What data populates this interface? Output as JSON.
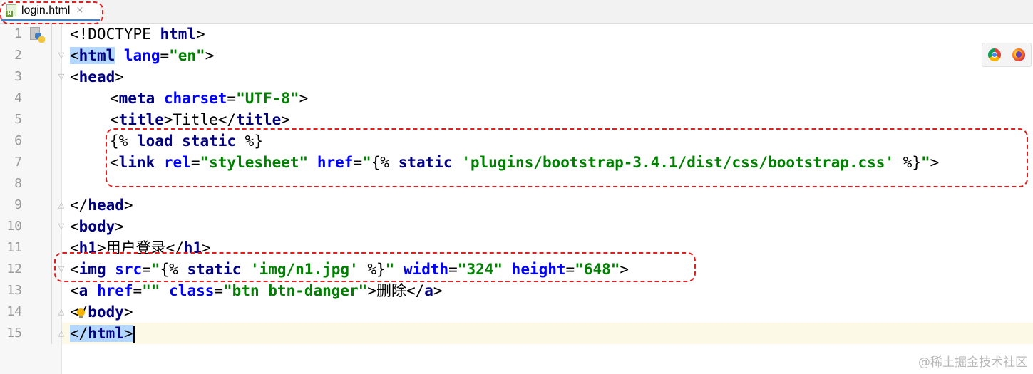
{
  "tab": {
    "label": "login.html",
    "close": "×"
  },
  "lines": [
    {
      "n": "1",
      "code": [
        [
          "p",
          "<!DOCTYPE "
        ],
        [
          "t",
          "html"
        ],
        [
          "p",
          ">"
        ]
      ]
    },
    {
      "n": "2",
      "code": [
        [
          "p hl",
          "<"
        ],
        [
          "t hl",
          "html"
        ],
        [
          "p",
          " "
        ],
        [
          "a",
          "lang"
        ],
        [
          "p",
          "="
        ],
        [
          "v",
          "\"en\""
        ],
        [
          "p",
          ">"
        ]
      ]
    },
    {
      "n": "3",
      "code": [
        [
          "p",
          "<"
        ],
        [
          "t",
          "head"
        ],
        [
          "p",
          ">"
        ]
      ]
    },
    {
      "n": "4",
      "indent": true,
      "code": [
        [
          "p",
          "<"
        ],
        [
          "t",
          "meta"
        ],
        [
          "p",
          " "
        ],
        [
          "a",
          "charset"
        ],
        [
          "p",
          "="
        ],
        [
          "v",
          "\"UTF-8\""
        ],
        [
          "p",
          ">"
        ]
      ]
    },
    {
      "n": "5",
      "indent": true,
      "code": [
        [
          "p",
          "<"
        ],
        [
          "t",
          "title"
        ],
        [
          "p",
          ">Title</"
        ],
        [
          "t",
          "title"
        ],
        [
          "p",
          ">"
        ]
      ]
    },
    {
      "n": "6",
      "indent": true,
      "code": [
        [
          "p",
          "{% "
        ],
        [
          "k",
          "load"
        ],
        [
          "p",
          " "
        ],
        [
          "k",
          "static"
        ],
        [
          "p",
          " %}"
        ]
      ]
    },
    {
      "n": "7",
      "indent": true,
      "code": [
        [
          "p",
          "<"
        ],
        [
          "t",
          "link"
        ],
        [
          "p",
          " "
        ],
        [
          "a",
          "rel"
        ],
        [
          "p",
          "="
        ],
        [
          "v",
          "\"stylesheet\""
        ],
        [
          "p",
          " "
        ],
        [
          "a",
          "href"
        ],
        [
          "p",
          "="
        ],
        [
          "v",
          "\""
        ],
        [
          "p",
          "{% "
        ],
        [
          "k",
          "static"
        ],
        [
          "p",
          " "
        ],
        [
          "v",
          "'plugins/bootstrap-3.4.1/dist/css/bootstrap.css'"
        ],
        [
          "p",
          " %}"
        ],
        [
          "v",
          "\""
        ],
        [
          "p",
          ">"
        ]
      ]
    },
    {
      "n": "8",
      "code": []
    },
    {
      "n": "9",
      "code": [
        [
          "p",
          "</"
        ],
        [
          "t",
          "head"
        ],
        [
          "p",
          ">"
        ]
      ]
    },
    {
      "n": "10",
      "code": [
        [
          "p",
          "<"
        ],
        [
          "t",
          "body"
        ],
        [
          "p",
          ">"
        ]
      ]
    },
    {
      "n": "11",
      "code": [
        [
          "p",
          "<"
        ],
        [
          "t",
          "h1"
        ],
        [
          "p",
          ">用户登录</"
        ],
        [
          "t",
          "h1"
        ],
        [
          "p",
          ">"
        ]
      ]
    },
    {
      "n": "12",
      "code": [
        [
          "p",
          "<"
        ],
        [
          "t",
          "img"
        ],
        [
          "p",
          " "
        ],
        [
          "a",
          "src"
        ],
        [
          "p",
          "="
        ],
        [
          "v",
          "\""
        ],
        [
          "p",
          "{% "
        ],
        [
          "k",
          "static"
        ],
        [
          "p",
          " "
        ],
        [
          "v",
          "'img/n1.jpg'"
        ],
        [
          "p",
          " %}"
        ],
        [
          "v",
          "\""
        ],
        [
          "p",
          " "
        ],
        [
          "a",
          "width"
        ],
        [
          "p",
          "="
        ],
        [
          "v",
          "\"324\""
        ],
        [
          "p",
          " "
        ],
        [
          "a",
          "height"
        ],
        [
          "p",
          "="
        ],
        [
          "v",
          "\"648\""
        ],
        [
          "p",
          ">"
        ]
      ]
    },
    {
      "n": "13",
      "code": [
        [
          "p",
          "<"
        ],
        [
          "t",
          "a"
        ],
        [
          "p",
          " "
        ],
        [
          "a",
          "href"
        ],
        [
          "p",
          "="
        ],
        [
          "v",
          "\"\""
        ],
        [
          "p",
          " "
        ],
        [
          "a",
          "class"
        ],
        [
          "p",
          "="
        ],
        [
          "v",
          "\"btn btn-danger\""
        ],
        [
          "p",
          ">删除</"
        ],
        [
          "t",
          "a"
        ],
        [
          "p",
          ">"
        ]
      ]
    },
    {
      "n": "14",
      "code": [
        [
          "p",
          "</"
        ],
        [
          "t",
          "body"
        ],
        [
          "p",
          ">"
        ]
      ]
    },
    {
      "n": "15",
      "code": [
        [
          "p hl",
          "</"
        ],
        [
          "t hl",
          "html"
        ],
        [
          "p hl",
          ">"
        ]
      ]
    }
  ],
  "browsers": [
    "chrome-icon",
    "firefox-icon"
  ],
  "watermark": "@稀土掘金技术社区",
  "colors": {
    "tag": "#000080",
    "attr": "#0000ff",
    "value": "#008000",
    "annotation": "#e02020",
    "current_line": "#fcfae6"
  }
}
